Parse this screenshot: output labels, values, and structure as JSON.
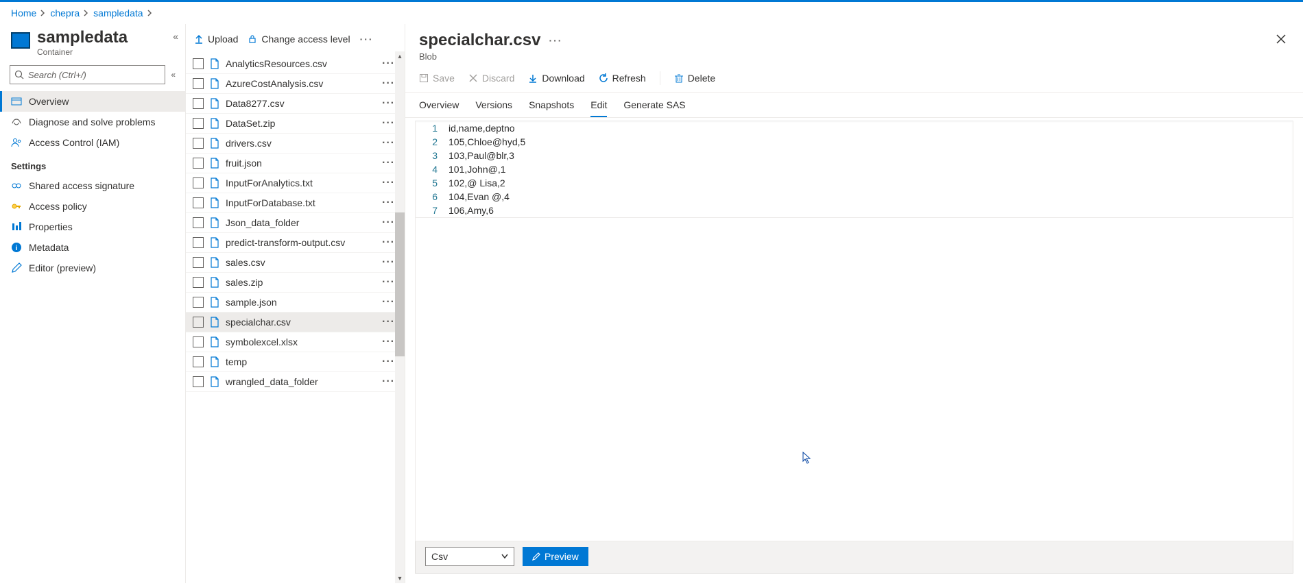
{
  "breadcrumb": [
    {
      "label": "Home"
    },
    {
      "label": "chepra"
    },
    {
      "label": "sampledata"
    }
  ],
  "page": {
    "title": "sampledata",
    "subtitle": "Container"
  },
  "search": {
    "placeholder": "Search (Ctrl+/)"
  },
  "nav": {
    "items": [
      {
        "label": "Overview",
        "active": true,
        "icon": "overview"
      },
      {
        "label": "Diagnose and solve problems",
        "icon": "diagnose"
      },
      {
        "label": "Access Control (IAM)",
        "icon": "iam"
      }
    ],
    "section_label": "Settings",
    "settings": [
      {
        "label": "Shared access signature",
        "icon": "sas"
      },
      {
        "label": "Access policy",
        "icon": "key"
      },
      {
        "label": "Properties",
        "icon": "props"
      },
      {
        "label": "Metadata",
        "icon": "info"
      },
      {
        "label": "Editor (preview)",
        "icon": "pencil"
      }
    ]
  },
  "middle_toolbar": {
    "upload": "Upload",
    "access": "Change access level"
  },
  "files": [
    {
      "name": "AnalyticsResources.csv",
      "selected": false
    },
    {
      "name": "AzureCostAnalysis.csv",
      "selected": false
    },
    {
      "name": "Data8277.csv",
      "selected": false
    },
    {
      "name": "DataSet.zip",
      "selected": false
    },
    {
      "name": "drivers.csv",
      "selected": false
    },
    {
      "name": "fruit.json",
      "selected": false
    },
    {
      "name": "InputForAnalytics.txt",
      "selected": false
    },
    {
      "name": "InputForDatabase.txt",
      "selected": false
    },
    {
      "name": "Json_data_folder",
      "selected": false
    },
    {
      "name": "predict-transform-output.csv",
      "selected": false
    },
    {
      "name": "sales.csv",
      "selected": false
    },
    {
      "name": "sales.zip",
      "selected": false
    },
    {
      "name": "sample.json",
      "selected": false
    },
    {
      "name": "specialchar.csv",
      "selected": true
    },
    {
      "name": "symbolexcel.xlsx",
      "selected": false
    },
    {
      "name": "temp",
      "selected": false
    },
    {
      "name": "wrangled_data_folder",
      "selected": false
    }
  ],
  "blob": {
    "title": "specialchar.csv",
    "subtitle": "Blob"
  },
  "actions": {
    "save": "Save",
    "discard": "Discard",
    "download": "Download",
    "refresh": "Refresh",
    "delete": "Delete"
  },
  "tabs": [
    {
      "label": "Overview",
      "active": false
    },
    {
      "label": "Versions",
      "active": false
    },
    {
      "label": "Snapshots",
      "active": false
    },
    {
      "label": "Edit",
      "active": true
    },
    {
      "label": "Generate SAS",
      "active": false
    }
  ],
  "editor_lines": [
    "id,name,deptno",
    "105,Chloe@hyd,5",
    "103,Paul@blr,3",
    "101,John@,1",
    "102,@ Lisa,2",
    "104,Evan @,4",
    "106,Amy,6"
  ],
  "footer": {
    "format": "Csv",
    "preview": "Preview"
  }
}
